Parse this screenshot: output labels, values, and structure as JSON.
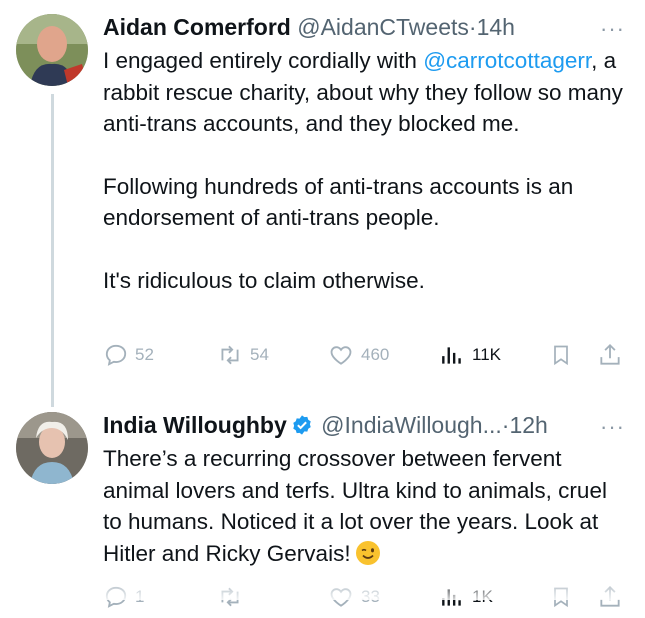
{
  "tweets": [
    {
      "name": "Aidan Comerford",
      "handle": "@AidanCTweets",
      "separator": "·",
      "time": "14h",
      "more": "···",
      "mention": "@carrotcottagerr",
      "line1": "I engaged entirely cordially with",
      "line2_rest": ", a rabbit rescue charity, about why they follow so many anti-trans accounts, and they blocked me.",
      "para2": "Following hundreds of anti-trans accounts is an endorsement of anti-trans people.",
      "para3": "It's ridiculous to claim otherwise.",
      "replies": "52",
      "retweets": "54",
      "likes": "460",
      "views": "11K"
    },
    {
      "name": "India Willoughby",
      "handle": "@IndiaWillough...",
      "separator": "·",
      "time": "12h",
      "more": "···",
      "text": "There’s a recurring crossover between fervent animal lovers and terfs. Ultra kind to animals, cruel to humans. Noticed it a lot over the years. Look at Hitler and Ricky Gervais!",
      "replies": "1",
      "likes": "33",
      "views": "1K"
    }
  ],
  "colors": {
    "link": "#1d9bf0",
    "muted": "#536471",
    "verified": "#1d9bf0",
    "action": "#a4b1bb"
  }
}
